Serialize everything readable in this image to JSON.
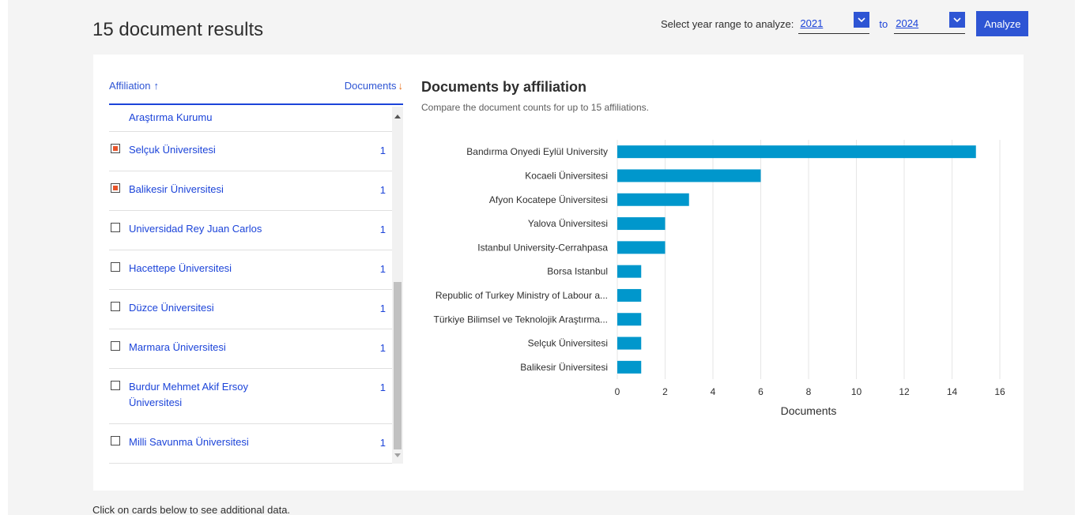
{
  "header": {
    "title": "15 document results",
    "year_label": "Select year range to analyze:",
    "year_from": "2021",
    "to_label": "to",
    "year_to": "2024",
    "analyze_label": "Analyze"
  },
  "affiliation_list": {
    "header_affiliation": "Affiliation",
    "header_documents": "Documents",
    "cut_item": "Araştırma Kurumu",
    "items": [
      {
        "name": "Selçuk Üniversitesi",
        "count": "1",
        "checked": true
      },
      {
        "name": "Balikesir Üniversitesi",
        "count": "1",
        "checked": true
      },
      {
        "name": "Universidad Rey Juan Carlos",
        "count": "1",
        "checked": false
      },
      {
        "name": "Hacettepe Üniversitesi",
        "count": "1",
        "checked": false
      },
      {
        "name": "Düzce Üniversitesi",
        "count": "1",
        "checked": false
      },
      {
        "name": "Marmara Üniversitesi",
        "count": "1",
        "checked": false
      },
      {
        "name": "Burdur Mehmet Akif Ersoy Üniversitesi",
        "count": "1",
        "checked": false
      },
      {
        "name": "Milli Savunma Üniversitesi",
        "count": "1",
        "checked": false
      }
    ]
  },
  "chart": {
    "title": "Documents by affiliation",
    "subtitle": "Compare the document counts for up to 15 affiliations."
  },
  "chart_data": {
    "type": "bar",
    "orientation": "horizontal",
    "categories": [
      "Bandırma Onyedi Eylül University",
      "Kocaeli Üniversitesi",
      "Afyon Kocatepe Üniversitesi",
      "Yalova Üniversitesi",
      "Istanbul University-Cerrahpasa",
      "Borsa Istanbul",
      "Republic of Turkey Ministry of Labour a...",
      "Türkiye Bilimsel ve Teknolojik Araştırma...",
      "Selçuk Üniversitesi",
      "Balikesir Üniversitesi"
    ],
    "values": [
      15,
      6,
      3,
      2,
      2,
      1,
      1,
      1,
      1,
      1
    ],
    "xlabel": "Documents",
    "xlim": [
      0,
      16
    ],
    "xticks": [
      0,
      2,
      4,
      6,
      8,
      10,
      12,
      14,
      16
    ],
    "grid": true,
    "bar_color": "#0097cc"
  },
  "footer": {
    "note": "Click on cards below to see additional data."
  },
  "colors": {
    "accent": "#2e55d4",
    "link": "#1c44d9",
    "sort_arrow": "#e9711c",
    "checkbox_fill": "#e8542a"
  }
}
